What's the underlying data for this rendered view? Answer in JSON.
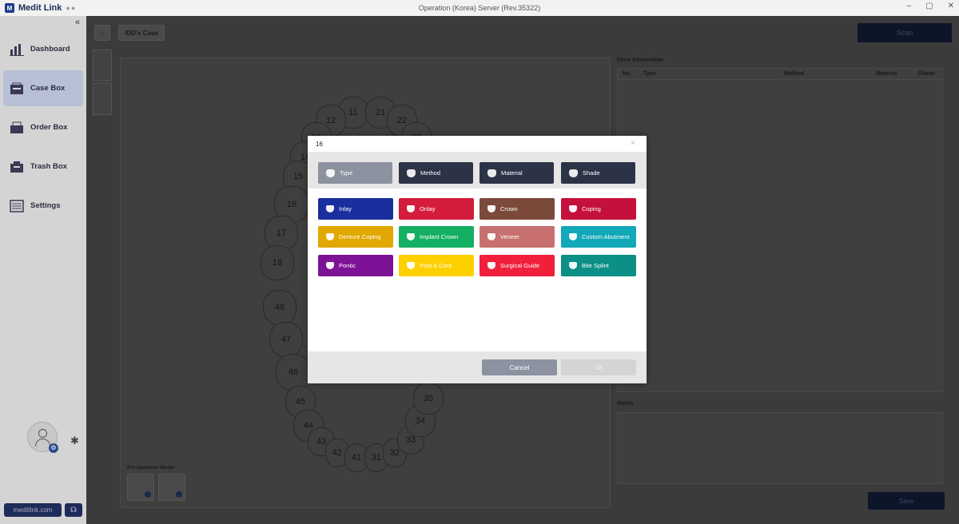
{
  "app": {
    "logo_text": "Medit Link",
    "window_title": "Operation (Korea) Server (Rev.35322)"
  },
  "sidebar": {
    "collapse_icon": "«",
    "items": [
      {
        "label": "Dashboard",
        "icon": "dashboard-icon"
      },
      {
        "label": "Case Box",
        "icon": "case-box-icon",
        "active": true
      },
      {
        "label": "Order Box",
        "icon": "order-box-icon"
      },
      {
        "label": "Trash Box",
        "icon": "trash-box-icon"
      },
      {
        "label": "Settings",
        "icon": "settings-icon"
      }
    ],
    "site_button": "meditlink.com"
  },
  "topbar": {
    "case_tab": "IDD's Case",
    "scan_label": "Scan"
  },
  "chart": {
    "teeth": [
      "11",
      "21",
      "12",
      "22",
      "13",
      "23",
      "14",
      "15",
      "16",
      "17",
      "18",
      "48",
      "47",
      "46",
      "45",
      "44",
      "43",
      "42",
      "41",
      "31",
      "32",
      "33",
      "34",
      "35"
    ],
    "preop_label": "Pre-Operation Model"
  },
  "form": {
    "title": "Form Information",
    "columns": [
      "No.",
      "Type",
      "Method",
      "Material",
      "Shade"
    ],
    "memo_title": "Memo",
    "save_label": "Save"
  },
  "modal": {
    "title": "16",
    "close_icon": "×",
    "tabs": [
      {
        "label": "Type",
        "icon": "type-icon",
        "active": true
      },
      {
        "label": "Method",
        "icon": "method-icon"
      },
      {
        "label": "Material",
        "icon": "material-icon"
      },
      {
        "label": "Shade",
        "icon": "shade-icon"
      }
    ],
    "types": [
      {
        "label": "Inlay",
        "color": "#1a2f9e",
        "icon": "inlay-icon"
      },
      {
        "label": "Onlay",
        "color": "#d41c3c",
        "icon": "onlay-icon"
      },
      {
        "label": "Crown",
        "color": "#7b4a3a",
        "icon": "crown-icon"
      },
      {
        "label": "Coping",
        "color": "#c4103a",
        "icon": "coping-icon"
      },
      {
        "label": "Denture Coping",
        "color": "#e0a800",
        "icon": "denture-coping-icon"
      },
      {
        "label": "Implant Crown",
        "color": "#13b063",
        "icon": "implant-crown-icon"
      },
      {
        "label": "Veneer",
        "color": "#c87070",
        "icon": "veneer-icon"
      },
      {
        "label": "Custom Abutment",
        "color": "#11a8b8",
        "icon": "custom-abutment-icon"
      },
      {
        "label": "Pontic",
        "color": "#7e1296",
        "icon": "pontic-icon"
      },
      {
        "label": "Post & Core",
        "color": "#ffd000",
        "icon": "post-core-icon"
      },
      {
        "label": "Surgical Guide",
        "color": "#f01f3c",
        "icon": "surgical-guide-icon"
      },
      {
        "label": "Bite Splint",
        "color": "#0c8f86",
        "icon": "bite-splint-icon"
      }
    ],
    "cancel_label": "Cancel",
    "ok_label": "OK"
  }
}
